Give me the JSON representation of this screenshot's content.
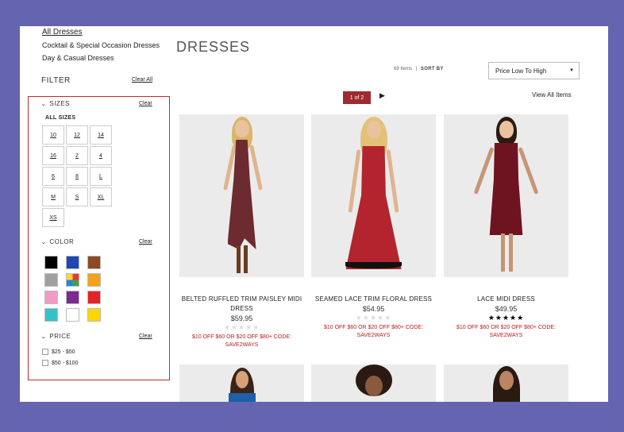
{
  "categories": [
    {
      "label": "All Dresses",
      "active": true
    },
    {
      "label": "Cocktail & Special Occasion Dresses",
      "active": false
    },
    {
      "label": "Day & Casual Dresses",
      "active": false
    }
  ],
  "filter": {
    "title": "FILTER",
    "clear_all": "Clear All",
    "sizes": {
      "heading": "SIZES",
      "clear": "Clear",
      "all_label": "ALL SIZES",
      "options": [
        "10",
        "12",
        "14",
        "16",
        "2",
        "4",
        "6",
        "8",
        "L",
        "M",
        "S",
        "XL",
        "XS"
      ]
    },
    "color": {
      "heading": "COLOR",
      "clear": "Clear",
      "swatches": [
        {
          "name": "black",
          "hex": "#000000"
        },
        {
          "name": "blue",
          "hex": "#1e47b3"
        },
        {
          "name": "brown",
          "hex": "#8b4a23"
        },
        {
          "name": "gray",
          "hex": "#a0a0a0"
        },
        {
          "name": "multi",
          "hex": "multi"
        },
        {
          "name": "orange",
          "hex": "#f5a21b"
        },
        {
          "name": "pink",
          "hex": "#f29ac6"
        },
        {
          "name": "purple",
          "hex": "#7b2a8f"
        },
        {
          "name": "red",
          "hex": "#e52226"
        },
        {
          "name": "teal",
          "hex": "#35c1c6"
        },
        {
          "name": "white",
          "hex": "#ffffff"
        },
        {
          "name": "yellow",
          "hex": "#ffd600"
        }
      ]
    },
    "price": {
      "heading": "PRICE",
      "clear": "Clear",
      "options": [
        "$25 - $50",
        "$50 - $100"
      ]
    }
  },
  "main": {
    "title": "DRESSES",
    "item_count": "69 Items",
    "separator": "|",
    "sort_label": "SORT BY",
    "sort_value": "Price Low To High",
    "pager": "1 of 2",
    "view_all": "View All Items"
  },
  "products": [
    {
      "name": "BELTED RUFFLED TRIM PAISLEY MIDI DRESS",
      "price": "$59.95",
      "rating": 0,
      "stars": "★★★★★",
      "promo": "$10 OFF $60 OR $20 OFF $80+ CODE: SAVE2WAYS",
      "dress_color": "#6b2b2f",
      "hair_color": "#d9b46a"
    },
    {
      "name": "SEAMED LACE TRIM FLORAL DRESS",
      "price": "$54.95",
      "rating": 0,
      "stars": "★★★★★",
      "promo": "$10 OFF $60 OR $20 OFF $80+ CODE: SAVE2WAYS",
      "dress_color": "#b3242e",
      "hair_color": "#e3c177"
    },
    {
      "name": "LACE MIDI DRESS",
      "price": "$49.95",
      "rating": 5,
      "stars": "★★★★★",
      "promo": "$10 OFF $60 OR $20 OFF $80+ CODE: SAVE2WAYS",
      "dress_color": "#6e1420",
      "hair_color": "#2a1a12"
    }
  ],
  "colors": {
    "accent_red": "#9e2b2f",
    "promo_red": "#b71c1c",
    "frame": "#6464b0"
  }
}
